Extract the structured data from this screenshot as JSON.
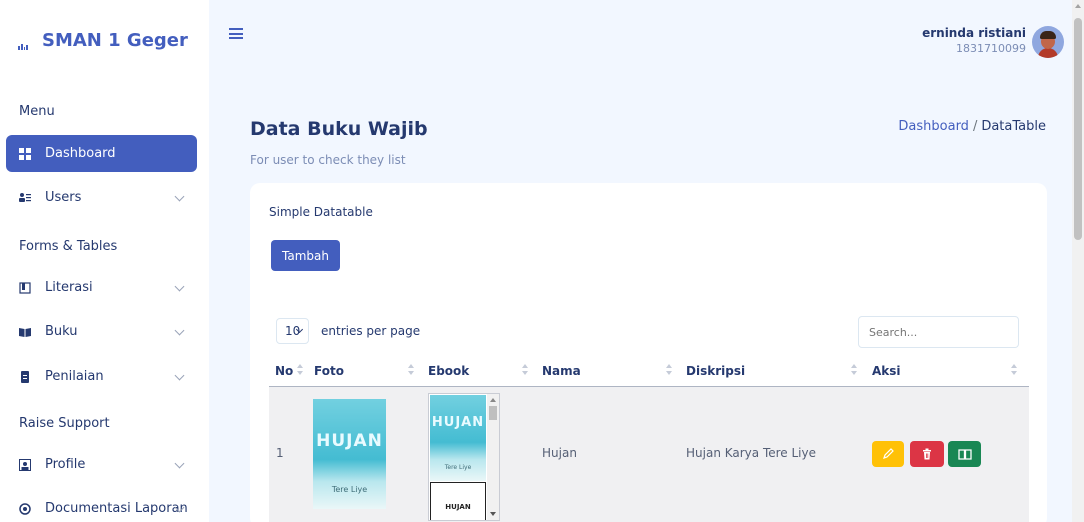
{
  "brand": {
    "title": "SMAN 1 Geger",
    "icon": "bar-chart-icon"
  },
  "sidebar": {
    "sections": [
      "Menu",
      "Forms & Tables",
      "Raise Support"
    ],
    "items": [
      {
        "label": "Dashboard",
        "icon": "grid-icon",
        "active": true
      },
      {
        "label": "Users",
        "icon": "users-icon"
      },
      {
        "label": "Literasi",
        "icon": "book-open-icon"
      },
      {
        "label": "Buku",
        "icon": "book-icon"
      },
      {
        "label": "Penilaian",
        "icon": "file-icon"
      },
      {
        "label": "Profile",
        "icon": "profile-icon"
      },
      {
        "label": "Documentasi Laporan",
        "icon": "globe-icon"
      }
    ]
  },
  "topbar": {
    "user_name": "erninda ristiani",
    "user_id": "1831710099"
  },
  "page": {
    "title": "Data Buku Wajib",
    "subtitle": "For user to check they list",
    "breadcrumb": {
      "home": "Dashboard",
      "separator": "/",
      "current": "DataTable"
    }
  },
  "card": {
    "title": "Simple Datatable",
    "add_button": "Tambah",
    "per_page": "10",
    "per_page_label": "entries per page",
    "search_placeholder": "Search..."
  },
  "table": {
    "headers": [
      "No",
      "Foto",
      "Ebook",
      "Nama",
      "Diskripsi",
      "Aksi"
    ],
    "rows": [
      {
        "no": "1",
        "cover_title": "HUJAN",
        "cover_author": "Tere Liye",
        "ebook_title": "HUJAN",
        "ebook_author": "Tere Liye",
        "ebook_page2": "HUJAN",
        "nama": "Hujan",
        "diskripsi": "Hujan Karya Tere Liye"
      }
    ]
  },
  "colors": {
    "primary": "#435ebe",
    "edit": "#ffc107",
    "delete": "#dc3545",
    "read": "#198754"
  }
}
